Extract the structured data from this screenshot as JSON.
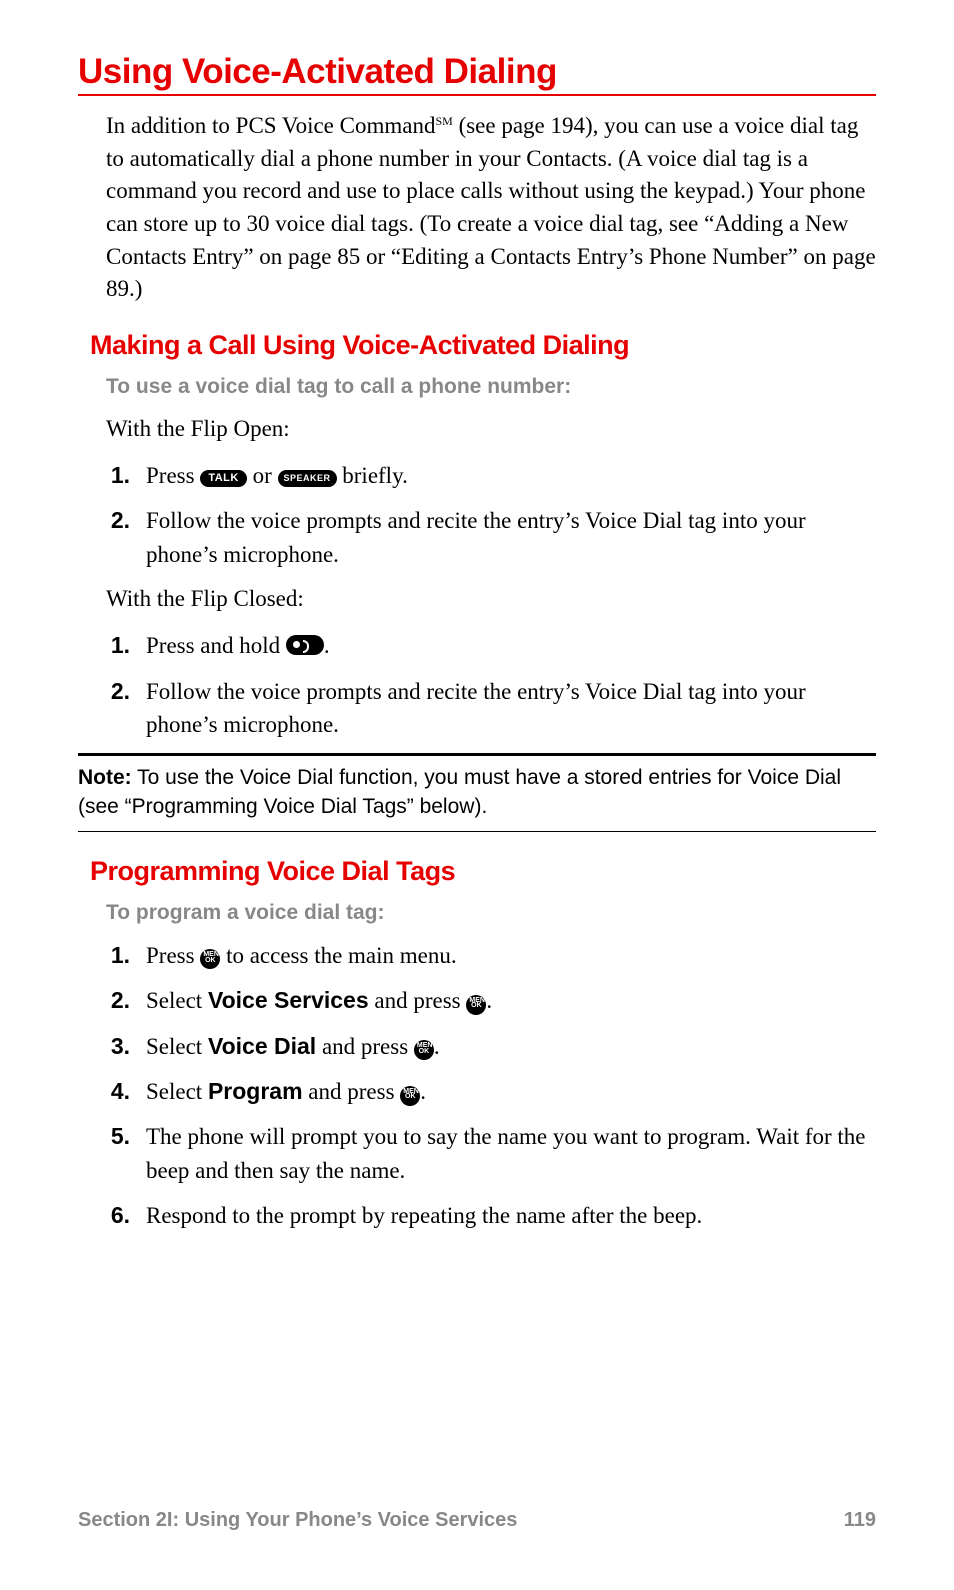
{
  "h1": "Using Voice-Activated Dialing",
  "intro_p1a": "In addition to PCS Voice Command",
  "intro_p1_sm": "SM",
  "intro_p1b": " (see page 194), you can use a voice dial tag to automatically dial a phone number in your Contacts. (A voice dial tag is a command you record and use to place calls without using the keypad.) Your phone can store up to 30 voice dial tags. (To create a voice dial tag, see “Adding a New Contacts Entry” on page 85 or “Editing a Contacts Entry’s Phone Number” on page 89.)",
  "h2_make": "Making a Call Using Voice-Activated Dialing",
  "sub_make": "To use a voice dial tag to call a phone number:",
  "flip_open": "With the Flip Open:",
  "open_steps": {
    "s1a": "Press ",
    "talk": "TALK",
    "s1b": " or ",
    "speaker": "SPEAKER",
    "s1c": " briefly.",
    "s2": "Follow the voice prompts and recite the entry’s Voice Dial tag into your phone’s microphone."
  },
  "flip_closed": "With the Flip Closed:",
  "closed_steps": {
    "s1a": "Press and hold ",
    "s1b": ".",
    "s2": "Follow the voice prompts and recite the entry’s Voice Dial tag into your phone’s microphone."
  },
  "note_label": "Note:",
  "note_text": " To use the Voice Dial function, you must have a stored entries for Voice Dial (see “Programming Voice Dial Tags” below).",
  "h2_prog": "Programming Voice Dial Tags",
  "sub_prog": "To program a voice dial tag:",
  "prog_steps": {
    "s1a": "Press ",
    "menuok": "MENU\nOK",
    "s1b": " to access the main menu.",
    "s2a": "Select ",
    "s2bold": "Voice Services",
    "s2b": " and press ",
    "s2c": ".",
    "s3a": "Select ",
    "s3bold": "Voice Dial",
    "s3b": " and press ",
    "s3c": ".",
    "s4a": "Select ",
    "s4bold": "Program",
    "s4b": " and press ",
    "s4c": ".",
    "s5": "The phone will prompt you to say the name you want to program. Wait for the beep and then say the name.",
    "s6": "Respond to the prompt by repeating the name after the beep."
  },
  "footer_left": "Section 2I: Using Your Phone’s Voice Services",
  "footer_right": "119",
  "nums": {
    "n1": "1.",
    "n2": "2.",
    "n3": "3.",
    "n4": "4.",
    "n5": "5.",
    "n6": "6."
  }
}
